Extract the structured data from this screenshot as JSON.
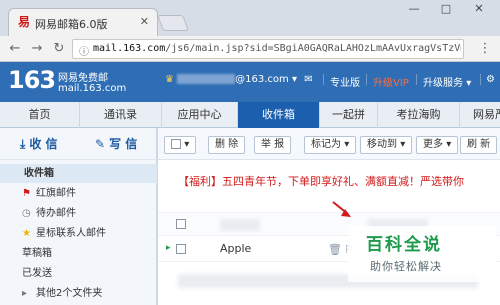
{
  "browser": {
    "tab_title": "网易邮箱6.0版",
    "tab_close": "✕",
    "url_host": "mail.163.com",
    "url_path": "/js6/main.jsp?sid=SBgiA0GAQRaLAHOzLmAAvUxragVsTzVm",
    "window_buttons": [
      "—",
      "□",
      "✕"
    ]
  },
  "header": {
    "logo_number": "163",
    "logo_name": "网易免费邮",
    "logo_domain": "mail.163.com",
    "user_suffix": "@163.com",
    "links": [
      "专业版",
      "升级VIP",
      "升级服务"
    ]
  },
  "nav_tabs": [
    "首页",
    "通讯录",
    "应用中心",
    "收件箱",
    "一起拼",
    "考拉海购",
    "网易严"
  ],
  "sidebar": {
    "receive_label": "收 信",
    "write_label": "写 信",
    "folders": [
      "收件箱",
      "红旗邮件",
      "待办邮件",
      "星标联系人邮件",
      "草稿箱",
      "已发送",
      "其他2个文件夹"
    ]
  },
  "toolbar": {
    "buttons": [
      "删 除",
      "举 报",
      "标记为",
      "移动到",
      "更多",
      "刷 新"
    ]
  },
  "promo_text": "【福利】五四青年节，下单即享好礼、满额直减！严选带你",
  "mail_rows": [
    {
      "sender": "Apple"
    }
  ],
  "watermark": {
    "title": "百科全说",
    "subtitle": "助你轻松解决"
  },
  "colors": {
    "header_blue": "#2f6eb5",
    "active_tab": "#1c5fae",
    "promo_red": "#d21a1a",
    "watermark_green": "#1d9b4d",
    "vip_orange": "#ff6b3d"
  }
}
